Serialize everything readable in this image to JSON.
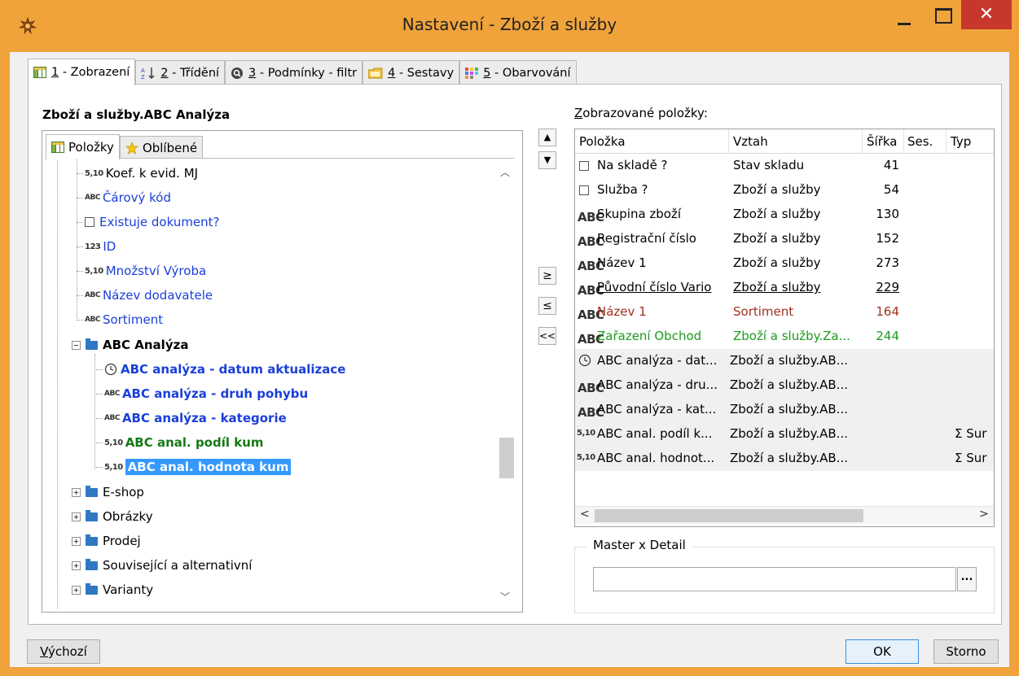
{
  "window": {
    "title": "Nastavení - Zboží a služby",
    "close_glyph": "✕"
  },
  "tabs": [
    {
      "num": "1",
      "label": " - Zobrazení",
      "icon": "grid-icon"
    },
    {
      "num": "2",
      "label": " - Třídění",
      "icon": "sort-az-icon"
    },
    {
      "num": "3",
      "label": " - Podmínky - filtr",
      "icon": "filter-search-icon"
    },
    {
      "num": "4",
      "label": " - Sestavy",
      "icon": "folder-report-icon"
    },
    {
      "num": "5",
      "label": " - Obarvování",
      "icon": "color-palette-icon"
    }
  ],
  "left": {
    "title": "Zboží a služby.ABC Analýza",
    "inner_tabs": [
      {
        "label": "Položky",
        "icon": "grid-icon"
      },
      {
        "label": "Oblíbené",
        "icon": "star-icon"
      }
    ],
    "tree": [
      {
        "type": "5,10",
        "label": "Koef. k evid. MJ",
        "style": "plain"
      },
      {
        "type": "ABC",
        "label": "Čárový kód",
        "style": "blue"
      },
      {
        "type": "box",
        "label": "Existuje dokument?",
        "style": "blue"
      },
      {
        "type": "123",
        "label": "ID",
        "style": "blue"
      },
      {
        "type": "5,10",
        "label": "Množství Výroba",
        "style": "blue"
      },
      {
        "type": "ABC",
        "label": "Název dodavatele",
        "style": "blue"
      },
      {
        "type": "ABC",
        "label": "Sortiment",
        "style": "blue"
      },
      {
        "type": "folder-open",
        "label": "ABC Analýza",
        "style": "bold"
      },
      {
        "type": "clock",
        "label": "ABC analýza - datum aktualizace",
        "style": "bblue"
      },
      {
        "type": "ABC",
        "label": "ABC analýza - druh pohybu",
        "style": "bblue"
      },
      {
        "type": "ABC",
        "label": "ABC analýza - kategorie",
        "style": "bblue"
      },
      {
        "type": "5,10",
        "label": "ABC anal. podíl kum",
        "style": "bgreen"
      },
      {
        "type": "5,10",
        "label": "ABC anal. hodnota kum",
        "style": "sel"
      },
      {
        "type": "folder",
        "label": "E-shop",
        "style": "plain"
      },
      {
        "type": "folder",
        "label": "Obrázky",
        "style": "plain"
      },
      {
        "type": "folder",
        "label": "Prodej",
        "style": "plain"
      },
      {
        "type": "folder",
        "label": "Související a alternativní",
        "style": "plain"
      },
      {
        "type": "folder",
        "label": "Varianty",
        "style": "plain"
      }
    ]
  },
  "middle_buttons": {
    "up": "▲",
    "down": "▼",
    "add": "≥",
    "remove": "≤",
    "remove_all": "<<"
  },
  "right": {
    "label_first": "Z",
    "label_rest": "obrazované položky:",
    "columns": [
      "Položka",
      "Vztah",
      "Šířka",
      "Ses.",
      "Typ"
    ],
    "rows": [
      {
        "icon": "box",
        "item": "Na skladě ?",
        "rel": "Stav skladu",
        "width": "41",
        "ses": "",
        "typ": "",
        "style": "plain"
      },
      {
        "icon": "box",
        "item": "Služba ?",
        "rel": "Zboží a služby",
        "width": "54",
        "ses": "",
        "typ": "",
        "style": "plain"
      },
      {
        "icon": "ABC",
        "item": "Skupina zboží",
        "rel": "Zboží a služby",
        "width": "130",
        "ses": "",
        "typ": "",
        "style": "plain"
      },
      {
        "icon": "ABC",
        "item": "Registrační číslo",
        "rel": "Zboží a služby",
        "width": "152",
        "ses": "",
        "typ": "",
        "style": "plain"
      },
      {
        "icon": "ABC",
        "item": "Název 1",
        "rel": "Zboží a služby",
        "width": "273",
        "ses": "",
        "typ": "",
        "style": "plain"
      },
      {
        "icon": "ABC",
        "item": "Původní číslo Vario",
        "rel": "Zboží a služby",
        "width": "229",
        "ses": "",
        "typ": "",
        "style": "underline"
      },
      {
        "icon": "ABC",
        "item": "Název 1",
        "rel": "Sortiment",
        "width": "164",
        "ses": "",
        "typ": "",
        "style": "red"
      },
      {
        "icon": "ABC",
        "item": "Zařazení Obchod",
        "rel": "Zboží a služby.Za...",
        "width": "244",
        "ses": "",
        "typ": "",
        "style": "green"
      },
      {
        "icon": "clock",
        "item": "ABC analýza - dat...",
        "rel": "Zboží a služby.AB...",
        "width": "",
        "ses": "",
        "typ": "",
        "style": "shade"
      },
      {
        "icon": "ABC",
        "item": "ABC analýza - dru...",
        "rel": "Zboží a služby.AB...",
        "width": "",
        "ses": "",
        "typ": "",
        "style": "shade"
      },
      {
        "icon": "ABC",
        "item": "ABC analýza - kat...",
        "rel": "Zboží a služby.AB...",
        "width": "",
        "ses": "",
        "typ": "",
        "style": "shade"
      },
      {
        "icon": "5,10",
        "item": "ABC anal. podíl k...",
        "rel": "Zboží a služby.AB...",
        "width": "",
        "ses": "",
        "typ": "Σ Sur",
        "style": "shade"
      },
      {
        "icon": "5,10",
        "item": "ABC anal. hodnot...",
        "rel": "Zboží a služby.AB...",
        "width": "",
        "ses": "",
        "typ": "Σ Sur",
        "style": "shade"
      }
    ],
    "master_detail_label": "Master x Detail",
    "master_detail_value": "",
    "ellipsis": "..."
  },
  "footer": {
    "default_first": "V",
    "default_rest": "ýchozí",
    "ok": "OK",
    "cancel": "Storno"
  }
}
